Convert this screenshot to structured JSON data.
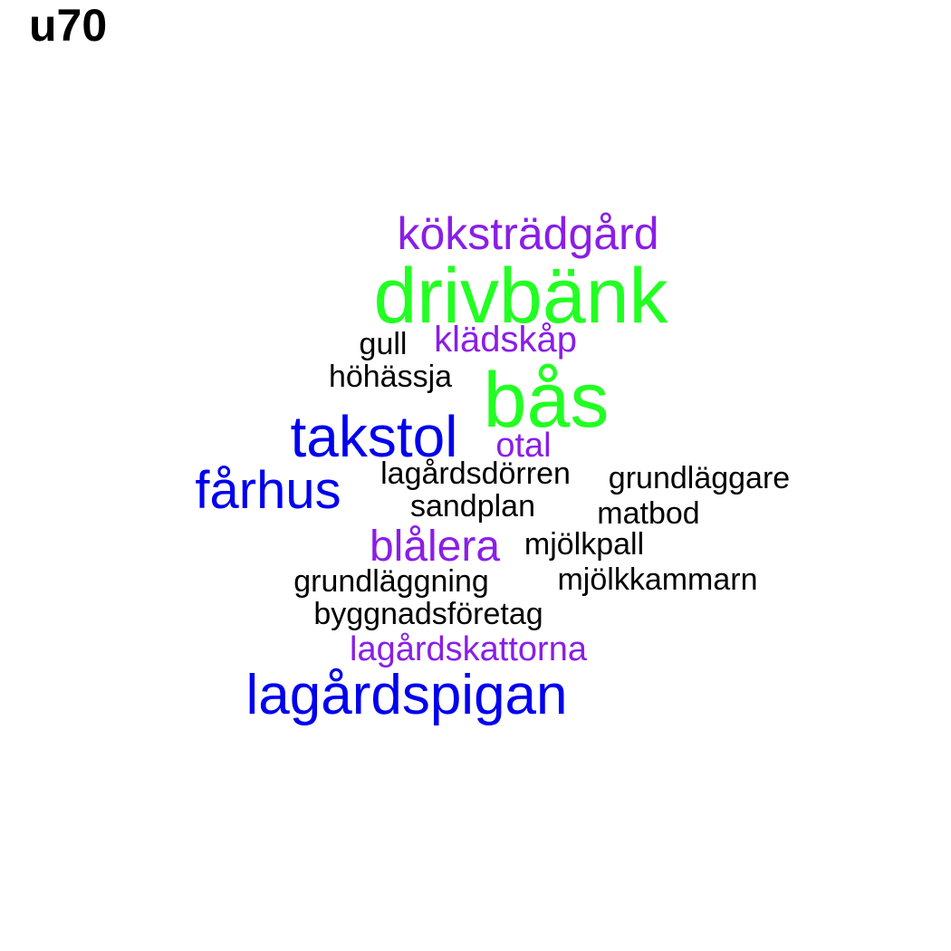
{
  "title": "u70",
  "colors": {
    "green": "#22ff22",
    "blue": "#0000ee",
    "purple": "#8a1ee6",
    "black": "#000000"
  },
  "words": [
    {
      "text": "drivbänk",
      "color": "green",
      "weight": 5
    },
    {
      "text": "bås",
      "color": "green",
      "weight": 5
    },
    {
      "text": "takstol",
      "color": "blue",
      "weight": 4
    },
    {
      "text": "fårhus",
      "color": "blue",
      "weight": 4
    },
    {
      "text": "lagårdspigan",
      "color": "blue",
      "weight": 4
    },
    {
      "text": "köksträdgård",
      "color": "purple",
      "weight": 3
    },
    {
      "text": "blålera",
      "color": "purple",
      "weight": 3
    },
    {
      "text": "klädskåp",
      "color": "purple",
      "weight": 2
    },
    {
      "text": "otal",
      "color": "purple",
      "weight": 2
    },
    {
      "text": "lagårdskattorna",
      "color": "purple",
      "weight": 2
    },
    {
      "text": "gull",
      "color": "black",
      "weight": 1
    },
    {
      "text": "höhässja",
      "color": "black",
      "weight": 1
    },
    {
      "text": "lagårdsdörren",
      "color": "black",
      "weight": 1
    },
    {
      "text": "grundläggare",
      "color": "black",
      "weight": 1
    },
    {
      "text": "sandplan",
      "color": "black",
      "weight": 1
    },
    {
      "text": "matbod",
      "color": "black",
      "weight": 1
    },
    {
      "text": "mjölkpall",
      "color": "black",
      "weight": 1
    },
    {
      "text": "grundläggning",
      "color": "black",
      "weight": 1
    },
    {
      "text": "mjölkkammarn",
      "color": "black",
      "weight": 1
    },
    {
      "text": "byggnadsföretag",
      "color": "black",
      "weight": 1
    }
  ]
}
